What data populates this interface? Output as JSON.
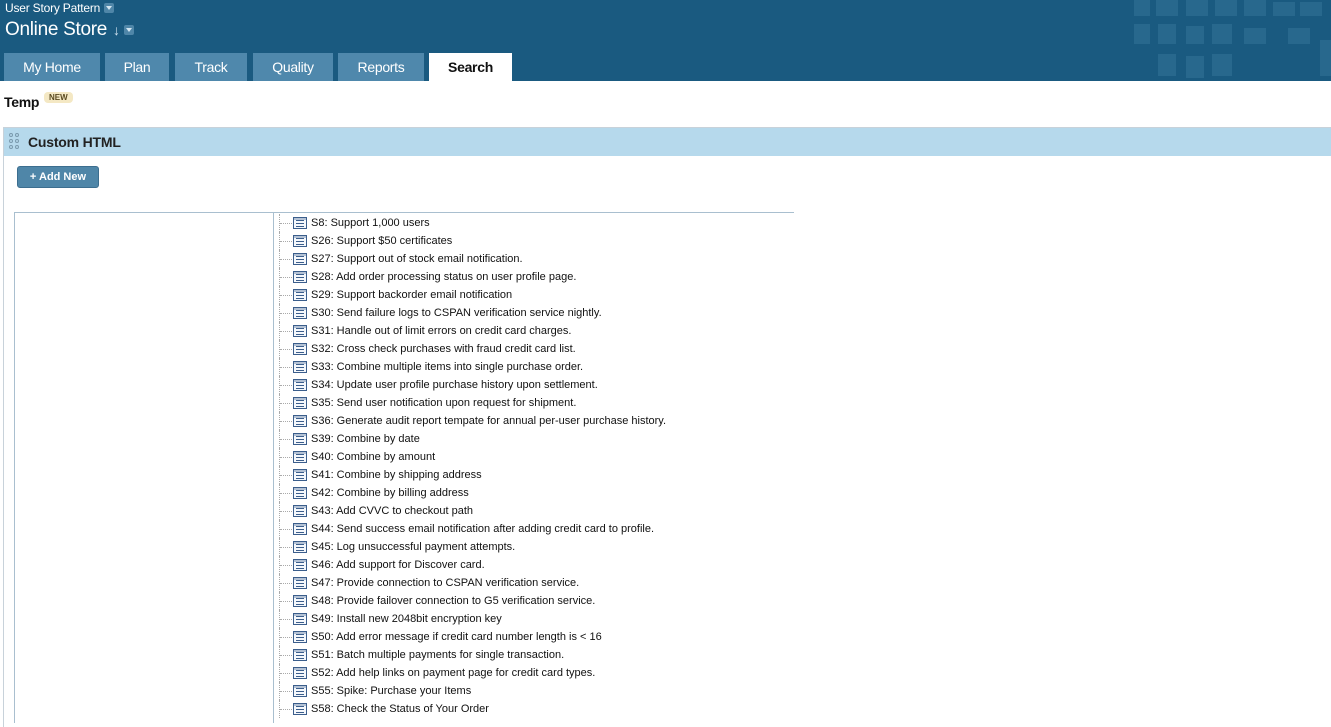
{
  "header": {
    "project_name": "User Story Pattern",
    "workspace_title": "Online Store",
    "workspace_arrow": "↓",
    "background_color": "#1a5a80"
  },
  "tabs": [
    {
      "label": "My Home",
      "active": false
    },
    {
      "label": "Plan",
      "active": false
    },
    {
      "label": "Track",
      "active": false
    },
    {
      "label": "Quality",
      "active": false
    },
    {
      "label": "Reports",
      "active": false
    },
    {
      "label": "Search",
      "active": true
    }
  ],
  "page": {
    "title": "Temp",
    "badge": "NEW"
  },
  "panel": {
    "title": "Custom HTML",
    "add_button_label": "+ Add New",
    "header_color": "#b6d9ec"
  },
  "stories": [
    "S8: Support 1,000 users",
    "S26: Support $50 certificates",
    "S27: Support out of stock email notification.",
    "S28: Add order processing status on user profile page.",
    "S29: Support backorder email notification",
    "S30: Send failure logs to CSPAN verification service nightly.",
    "S31: Handle out of limit errors on credit card charges.",
    "S32: Cross check purchases with fraud credit card list.",
    "S33: Combine multiple items into single purchase order.",
    "S34: Update user profile purchase history upon settlement.",
    "S35: Send user notification upon request for shipment.",
    "S36: Generate audit report tempate for annual per-user purchase history.",
    "S39: Combine by date",
    "S40: Combine by amount",
    "S41: Combine by shipping address",
    "S42: Combine by billing address",
    "S43: Add CVVC to checkout path",
    "S44: Send success email notification after adding credit card to profile.",
    "S45: Log unsuccessful payment attempts.",
    "S46: Add support for Discover card.",
    "S47: Provide connection to CSPAN verification service.",
    "S48: Provide failover connection to G5 verification service.",
    "S49: Install new 2048bit encryption key",
    "S50: Add error message if credit card number length is < 16",
    "S51: Batch multiple payments for single transaction.",
    "S52: Add help links on payment page for credit card types.",
    "S55: Spike: Purchase your Items",
    "S58: Check the Status of Your Order"
  ]
}
